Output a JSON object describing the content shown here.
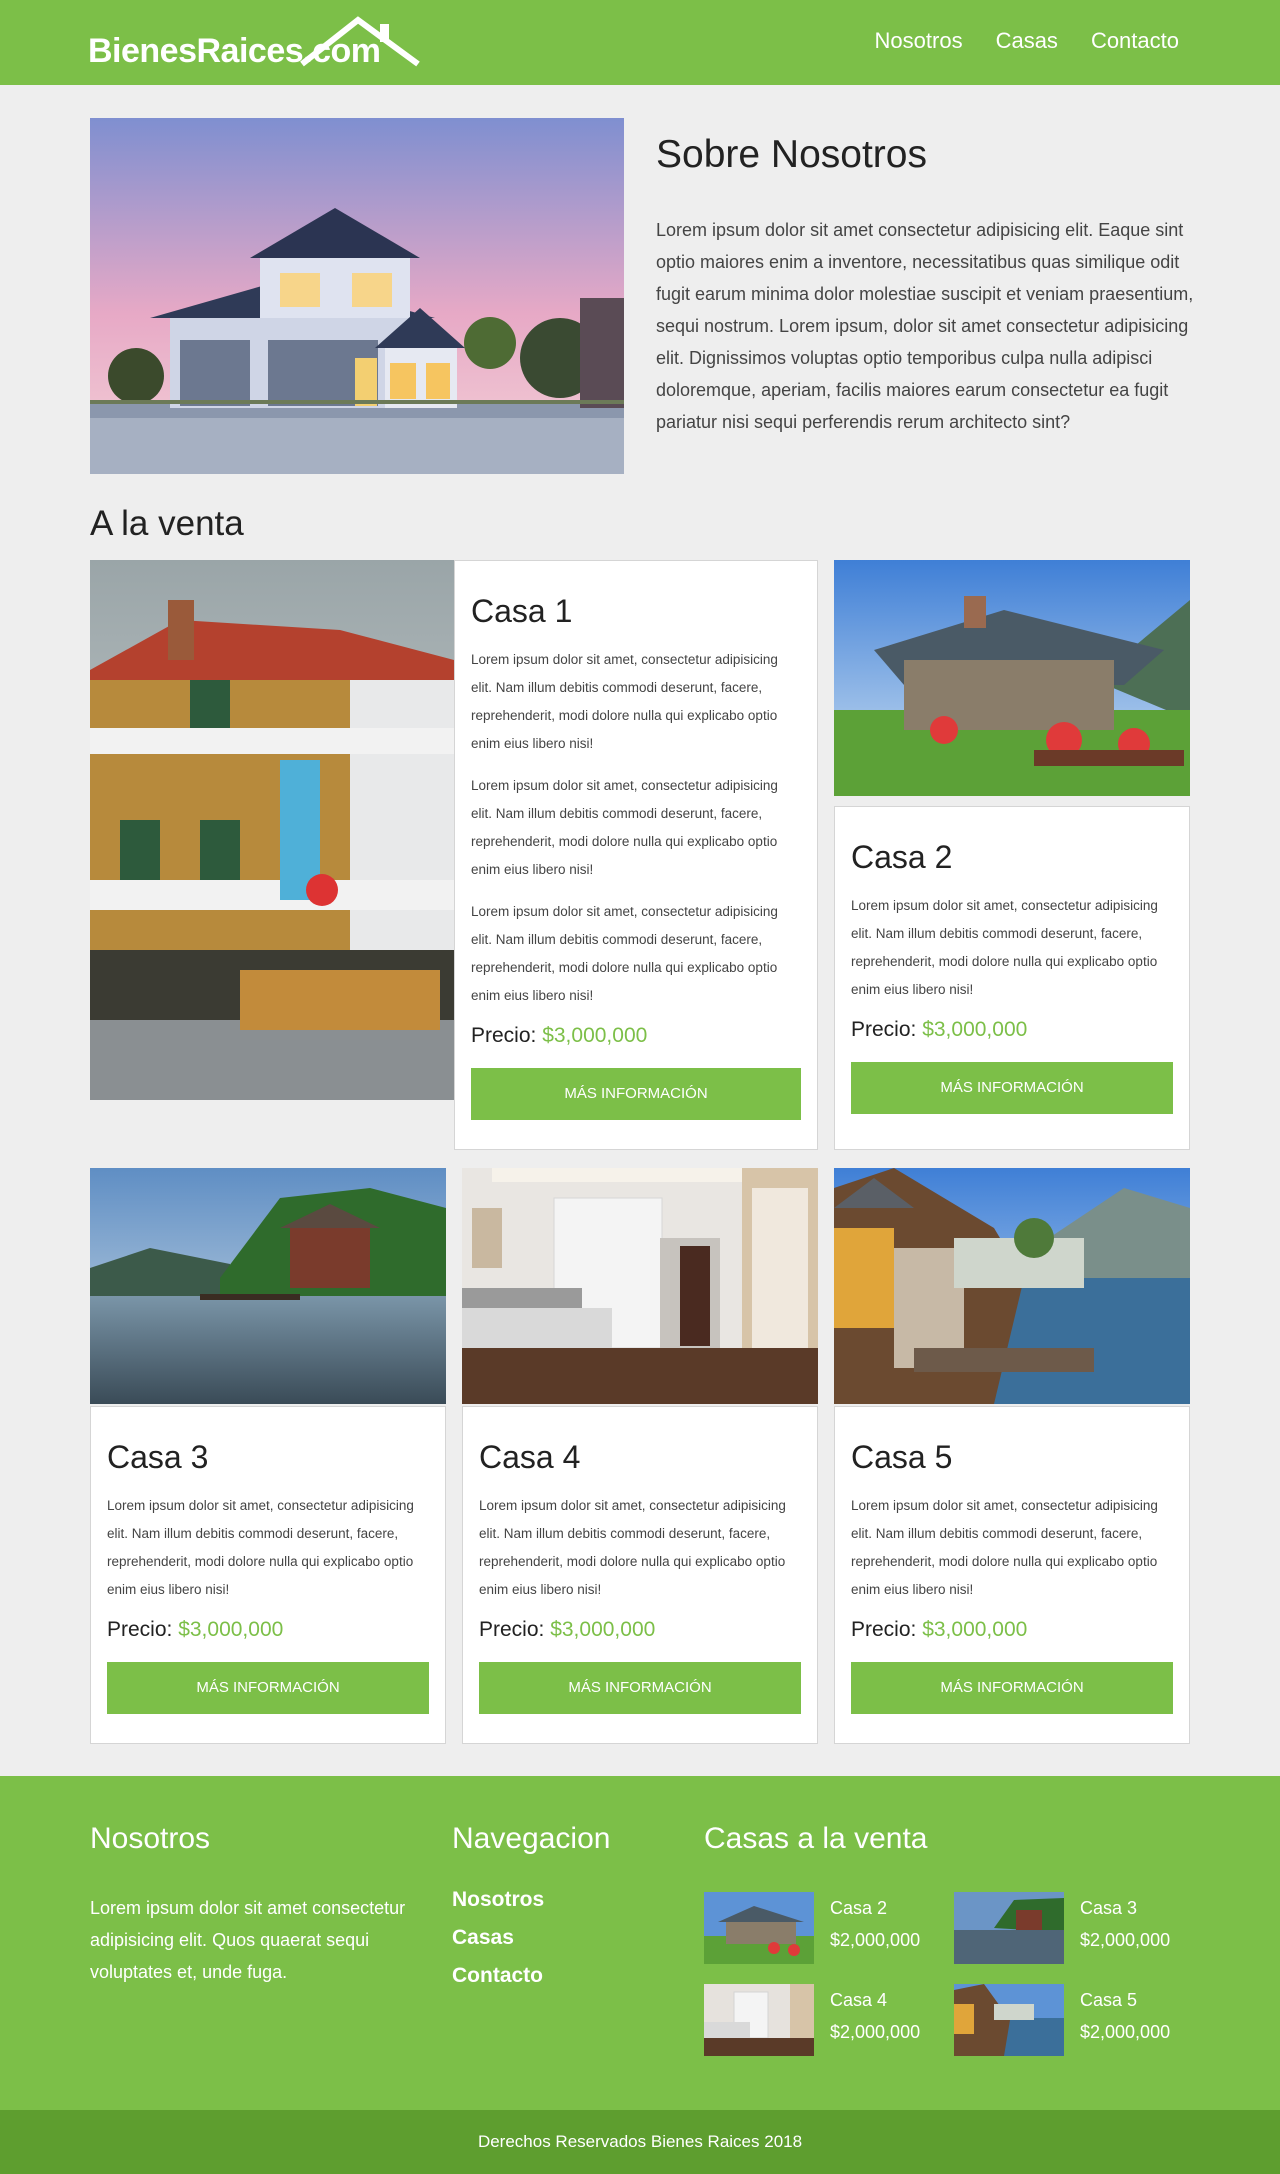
{
  "header": {
    "logo_text": "BienesRaices.com",
    "nav": [
      "Nosotros",
      "Casas",
      "Contacto"
    ]
  },
  "about": {
    "title": "Sobre Nosotros",
    "text": "Lorem ipsum dolor sit amet consectetur adipisicing elit. Eaque sint optio maiores enim a inventore, necessitatibus quas similique odit fugit earum minima dolor molestiae suscipit et veniam praesentium, sequi nostrum. Lorem ipsum, dolor sit amet consectetur adipisicing elit. Dignissimos voluptas optio temporibus culpa nulla adipisci doloremque, aperiam, facilis maiores earum consectetur ea fugit pariatur nisi sequi perferendis rerum architecto sint?"
  },
  "sale_title": "A la venta",
  "listing": {
    "text": "Lorem ipsum dolor sit amet, consectetur adipisicing elit. Nam illum debitis commodi deserunt, facere, reprehenderit, modi dolore nulla qui explicabo optio enim eius libero nisi!",
    "price_label": "Precio:",
    "price_value": "$3,000,000",
    "button": "MÁS INFORMACIÓN"
  },
  "houses": [
    {
      "name": "Casa 1"
    },
    {
      "name": "Casa 2"
    },
    {
      "name": "Casa 3"
    },
    {
      "name": "Casa 4"
    },
    {
      "name": "Casa 5"
    }
  ],
  "footer": {
    "about_title": "Nosotros",
    "about_text": "Lorem ipsum dolor sit amet consectetur adipisicing elit. Quos quaerat sequi voluptates et, unde fuga.",
    "nav_title": "Navegacion",
    "nav": [
      "Nosotros",
      "Casas",
      "Contacto"
    ],
    "sale_title": "Casas a la venta",
    "items": [
      {
        "name": "Casa 2",
        "price": "$2,000,000"
      },
      {
        "name": "Casa 3",
        "price": "$2,000,000"
      },
      {
        "name": "Casa 4",
        "price": "$2,000,000"
      },
      {
        "name": "Casa 5",
        "price": "$2,000,000"
      }
    ],
    "copyright": "Derechos Reservados Bienes Raices 2018"
  },
  "colors": {
    "brand_green": "#7cbf48",
    "footer_dark": "#5e9e2f",
    "page_bg": "#eeeeee"
  },
  "icons": [
    "house-roof-logo-icon"
  ]
}
